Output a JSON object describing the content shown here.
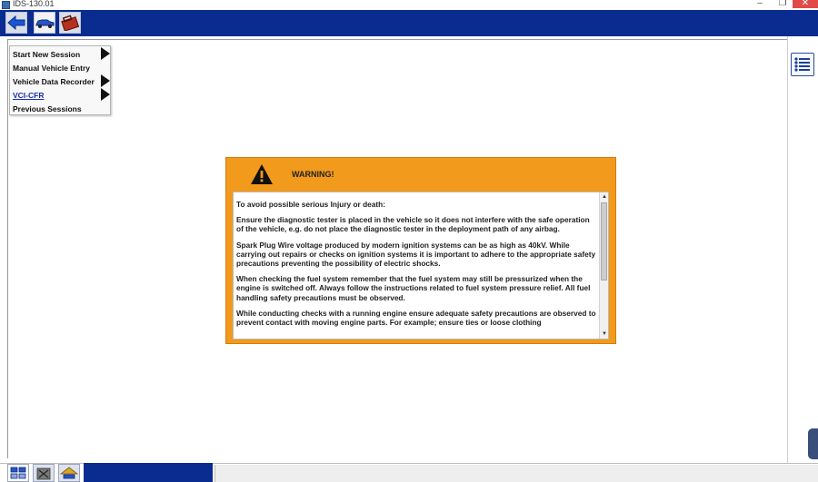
{
  "window": {
    "title": "IDS-130.01",
    "min_glyph": "–",
    "max_glyph": "❐",
    "close_glyph": "✕"
  },
  "toolbar": {
    "buttons": [
      {
        "icon": "back-arrow-icon"
      },
      {
        "icon": "vehicle-icon",
        "active": true
      },
      {
        "icon": "toolbox-icon"
      }
    ]
  },
  "session_menu": {
    "items": [
      {
        "label": "Start New Session",
        "has_submenu": true
      },
      {
        "label": "Manual Vehicle Entry",
        "has_submenu": false
      },
      {
        "label": "Vehicle Data Recorder",
        "has_submenu": true
      },
      {
        "label": "VCI-CFR",
        "has_submenu": true,
        "link": true
      },
      {
        "label": "Previous Sessions",
        "has_submenu": false
      }
    ]
  },
  "warning": {
    "title": "WARNING!",
    "paragraphs": [
      "To avoid possible serious Injury or death:",
      "Ensure the diagnostic tester is placed in the vehicle so it does not interfere with the safe operation of the vehicle, e.g. do not place the diagnostic tester in the deployment path of any airbag.",
      "Spark Plug Wire voltage produced by modern ignition systems can be as high as 40kV. While carrying out repairs or checks on ignition systems it is important to adhere to the appropriate safety precautions preventing the possibility of electric shocks.",
      "When checking the fuel system remember that the fuel system may still be pressurized when the engine is switched off. Always follow the instructions related to fuel system pressure relief. All fuel handling safety precautions must be observed.",
      "While conducting checks with a running engine ensure adequate safety precautions are observed to prevent contact with moving engine parts. For example; ensure ties or loose clothing"
    ]
  },
  "right_panel": {
    "icon": "list-icon"
  },
  "bottom_tabs": [
    {
      "icon": "session-icon",
      "active": true
    },
    {
      "icon": "building-icon"
    },
    {
      "icon": "car-garage-icon"
    }
  ],
  "colors": {
    "toolbar_blue": "#0a2b8f",
    "warning_orange": "#f29a1c"
  }
}
